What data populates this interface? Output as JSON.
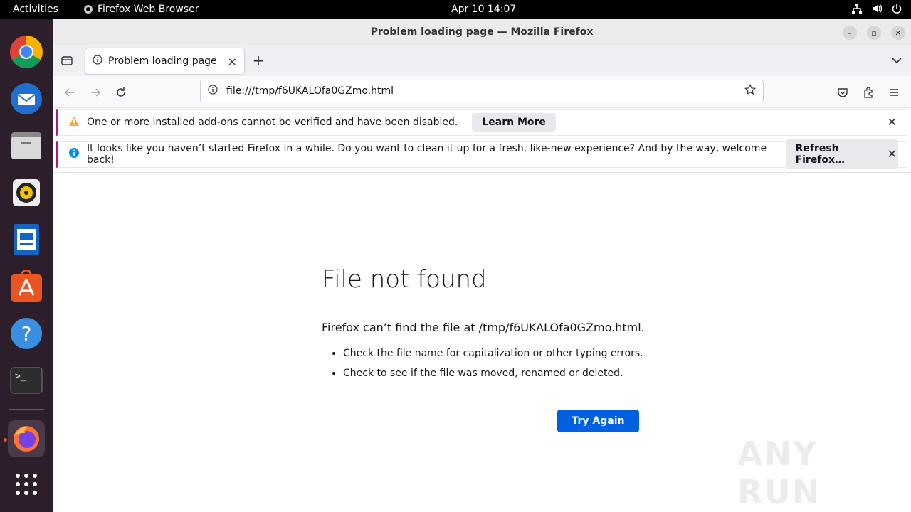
{
  "topbar": {
    "activities": "Activities",
    "app_name": "Firefox Web Browser",
    "clock": "Apr 10  14:07"
  },
  "dock": {
    "items": [
      "chrome-icon",
      "thunderbird-icon",
      "files-icon",
      "rhythmbox-icon",
      "writer-icon",
      "app-center-icon",
      "help-icon",
      "terminal-icon",
      "firefox-icon",
      "app-grid-icon"
    ]
  },
  "window": {
    "title": "Problem loading page — Mozilla Firefox"
  },
  "tab": {
    "title": "Problem loading page"
  },
  "url": {
    "value": "file:///tmp/f6UKALOfa0GZmo.html"
  },
  "notifications": [
    {
      "message": "One or more installed add-ons cannot be verified and have been disabled.",
      "button": "Learn More"
    },
    {
      "message": "It looks like you haven’t started Firefox in a while. Do you want to clean it up for a fresh, like-new experience? And by the way, welcome back!",
      "button": "Refresh Firefox…"
    }
  ],
  "error": {
    "title": "File not found",
    "description": "Firefox can’t find the file at /tmp/f6UKALOfa0GZmo.html.",
    "tips": [
      "Check the file name for capitalization or other typing errors.",
      "Check to see if the file was moved, renamed or deleted."
    ],
    "button": "Try Again"
  },
  "watermark": "ANY RUN",
  "colors": {
    "accent": "#0061e0",
    "dock_bg": "#2c1f2b",
    "notification_border": "#b7157d"
  }
}
